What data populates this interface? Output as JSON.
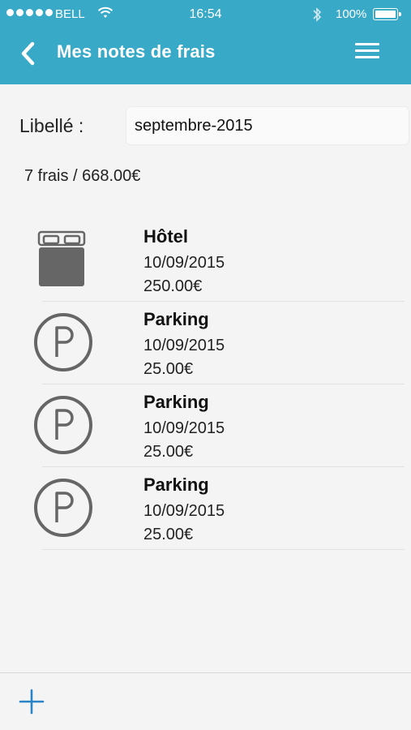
{
  "status_bar": {
    "carrier": "BELL",
    "time": "16:54",
    "battery": "100%"
  },
  "navbar": {
    "title": "Mes notes de frais",
    "back_icon": "chevron-left-icon",
    "menu_icon": "hamburger-menu-icon"
  },
  "form": {
    "label": "Libellé :",
    "value": "septembre-2015"
  },
  "summary": "7 frais / 668.00€",
  "expenses": [
    {
      "icon": "bed-icon",
      "name": "Hôtel",
      "date": "10/09/2015",
      "amount": "250.00€"
    },
    {
      "icon": "parking-icon",
      "name": "Parking",
      "date": "10/09/2015",
      "amount": "25.00€"
    },
    {
      "icon": "parking-icon",
      "name": "Parking",
      "date": "10/09/2015",
      "amount": "25.00€"
    },
    {
      "icon": "parking-icon",
      "name": "Parking",
      "date": "10/09/2015",
      "amount": "25.00€"
    }
  ],
  "toolbar": {
    "add_icon": "plus-icon"
  },
  "colors": {
    "header": "#39a9c8",
    "accent": "#2a85c8",
    "icon": "#666666"
  }
}
